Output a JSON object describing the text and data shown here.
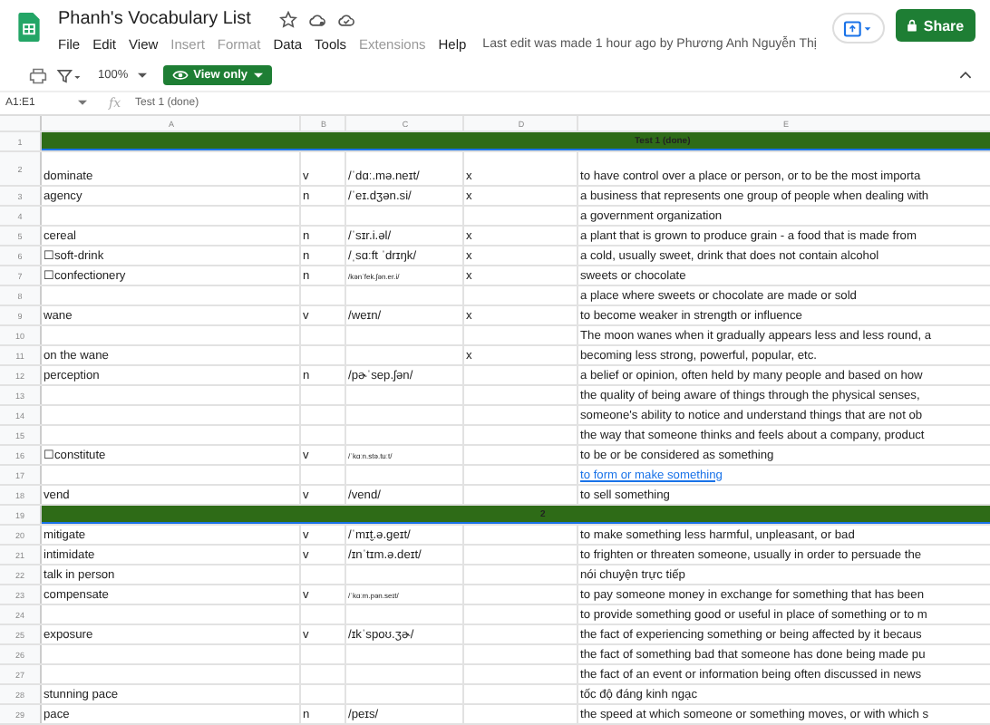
{
  "document": {
    "title": "Phanh's Vocabulary List",
    "last_edit": "Last edit was made 1 hour ago by Phương Anh Nguyễn Thị"
  },
  "menu": [
    {
      "label": "File",
      "disabled": false
    },
    {
      "label": "Edit",
      "disabled": false
    },
    {
      "label": "View",
      "disabled": false
    },
    {
      "label": "Insert",
      "disabled": true
    },
    {
      "label": "Format",
      "disabled": true
    },
    {
      "label": "Data",
      "disabled": false
    },
    {
      "label": "Tools",
      "disabled": false
    },
    {
      "label": "Extensions",
      "disabled": true
    },
    {
      "label": "Help",
      "disabled": false
    }
  ],
  "share_button": "Share",
  "toolbar": {
    "zoom": "100%",
    "mode": "View only"
  },
  "formula_bar": {
    "cell_range": "A1:E1",
    "fx": "fx",
    "value": "Test 1 (done)"
  },
  "columns": [
    "A",
    "B",
    "C",
    "D",
    "E"
  ],
  "rows": [
    {
      "n": "1",
      "kind": "section",
      "label": "Test 1 (done)"
    },
    {
      "n": "2",
      "kind": "data",
      "a": "dominate",
      "b": "v",
      "c": "/ˈdɑː.mə.neɪt/",
      "d": "x",
      "e": "to have control over a place or person, or to be the most importa"
    },
    {
      "n": "3",
      "kind": "data",
      "a": " agency",
      "b": "n",
      "c": "/ˈeɪ.dʒən.si/",
      "d": "x",
      "e": "a business that represents one group of people when dealing with"
    },
    {
      "n": "4",
      "kind": "data",
      "e": "a government organization"
    },
    {
      "n": "5",
      "kind": "data",
      "a": "cereal",
      "b": "n",
      "c": "/ˈsɪr.i.əl/",
      "d": "x",
      "e": "a plant that is grown to produce grain - a food that is made from"
    },
    {
      "n": "6",
      "kind": "data",
      "a": "☐soft-drink",
      "b": "n",
      "c": "/ˌsɑːft ˈdrɪŋk/",
      "d": "x",
      "e": "a cold, usually sweet, drink that does not contain alcohol"
    },
    {
      "n": "7",
      "kind": "data",
      "a": "☐confectionery",
      "b": "n",
      "c": "/kənˈfek.ʃən.er.i/",
      "d": "x",
      "e": "sweets or chocolate"
    },
    {
      "n": "8",
      "kind": "data",
      "e": "a place where sweets or chocolate are made or sold"
    },
    {
      "n": "9",
      "kind": "data",
      "a": " wane",
      "b": "v",
      "c": "/weɪn/",
      "d": "x",
      "e": "to become weaker in strength or influence"
    },
    {
      "n": "10",
      "kind": "data",
      "e": "The moon wanes when it gradually appears less and less round, a"
    },
    {
      "n": "11",
      "kind": "data",
      "a": "on the wane",
      "d": "x",
      "e": "becoming less strong, powerful, popular, etc."
    },
    {
      "n": "12",
      "kind": "data",
      "a": "perception",
      "b": "n",
      "c": "/pɚˈsep.ʃən/",
      "e": "a belief or opinion, often held by many people and based on how"
    },
    {
      "n": "13",
      "kind": "data",
      "e": "the quality of being aware of things through the physical senses,"
    },
    {
      "n": "14",
      "kind": "data",
      "e": "someone's ability to notice and understand things that are not ob"
    },
    {
      "n": "15",
      "kind": "data",
      "e": "the way that someone thinks and feels about a company, product"
    },
    {
      "n": "16",
      "kind": "data",
      "a": "☐constitute",
      "b": "v",
      "c": "/ˈkɑːn.stə.tuːt/",
      "e": "to be or be considered as something"
    },
    {
      "n": "17",
      "kind": "link",
      "e": "to form or make something"
    },
    {
      "n": "18",
      "kind": "data",
      "a": "vend",
      "b": "v",
      "c": "/vend/",
      "e": "to sell something"
    },
    {
      "n": "19",
      "kind": "section",
      "label": "2"
    },
    {
      "n": "20",
      "kind": "data",
      "a": "mitigate",
      "b": "v",
      "c": "/ˈmɪt̬.ə.ɡeɪt/",
      "e": "to make something less harmful, unpleasant, or bad"
    },
    {
      "n": "21",
      "kind": "data",
      "a": "intimidate",
      "b": "v",
      "c": "/ɪnˈtɪm.ə.deɪt/",
      "e": "to frighten or threaten someone, usually in order to persuade the"
    },
    {
      "n": "22",
      "kind": "data",
      "a": "talk in person",
      "e": "nói chuyện trực tiếp"
    },
    {
      "n": "23",
      "kind": "data",
      "a": "compensate",
      "b": "v",
      "c": "/ˈkɑːm.pən.seɪt/",
      "e": "to pay someone money in exchange for something that has been"
    },
    {
      "n": "24",
      "kind": "data",
      "e": "to provide something good or useful in place of something or to m"
    },
    {
      "n": "25",
      "kind": "data",
      "a": "exposure",
      "b": "v",
      "c": "/ɪkˈspoʊ.ʒɚ/",
      "e": "the fact of experiencing something or being affected by it becaus"
    },
    {
      "n": "26",
      "kind": "data",
      "e": "the fact of something bad that someone has done being made pu"
    },
    {
      "n": "27",
      "kind": "data",
      "e": "the fact of an event or information being often discussed in news"
    },
    {
      "n": "28",
      "kind": "data",
      "a": "stunning pace",
      "e": " tốc độ đáng kinh ngạc"
    },
    {
      "n": "29",
      "kind": "data",
      "a": "pace",
      "b": "n",
      "c": "/peɪs/",
      "e": "the speed at which someone or something moves, or with which s"
    }
  ]
}
